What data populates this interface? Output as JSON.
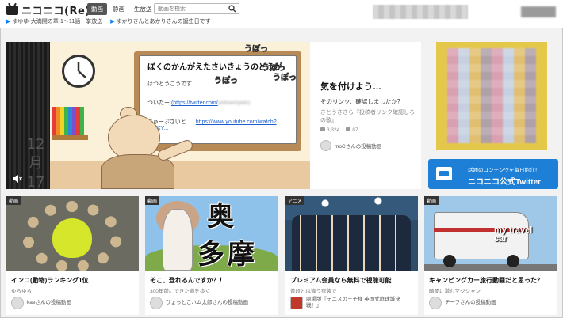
{
  "header": {
    "logo_text": "ニコニコ(Re)",
    "tabs": [
      {
        "label": "動画",
        "active": true
      },
      {
        "label": "静画",
        "active": false
      },
      {
        "label": "生放送",
        "active": false
      }
    ],
    "search_placeholder": "動画を検索",
    "ticker": [
      "ゆゆゆ-大満開の章-1〜11話一挙放送",
      "ゆかりさんとあかりさんの誕生日です"
    ]
  },
  "hero": {
    "board_title": "ぼくのかんがえたさいきょうのどうが",
    "board_line1": "はつとうこうです",
    "board_line2_prefix": "ついたー",
    "board_line2_link": "(https://twitter.com/",
    "board_line2_blur": "yellowmjado)",
    "board_line3_prefix": "ちゅーぶさいと",
    "board_line3_link": "https://www.youtube.com/watch?v=FXY...",
    "puff_text": "うぽっ",
    "date_v1": "12",
    "date_v2": "月",
    "date_v3": "17",
    "title": "気を付けよう…",
    "subtitle": "そのリンク、確認しましたか？",
    "description": "さとうささら『投稿者リンク確認しろの歌』",
    "views": "3,324",
    "comments": "87",
    "author": "moCさんの投稿動画"
  },
  "sidebar": {
    "twitter_small": "話題のコンテンツを毎日紹介！",
    "twitter_big": "ニコニコ公式Twitter"
  },
  "cards": [
    {
      "badge": "動画",
      "title": "インコ(動物)ランキング1位",
      "sub": "ゆらゆら",
      "author": "kaeさんの投稿動画"
    },
    {
      "badge": "動画",
      "title": "そこ、登れるんですか？！",
      "sub": "300年前にできた道を歩く",
      "author": "ひょっとこハム太郎さんの投稿動画",
      "kanji1": "奥",
      "kanji2": "多摩"
    },
    {
      "badge": "アニメ",
      "title": "プレミアム会員なら無料で視聴可能",
      "sub": "普段とは違う衣装で",
      "author": "劇場版『テニスの王子様 英国式庭球城決戦！』"
    },
    {
      "badge": "動画",
      "title": "キャンピングカー旅行動画だと思った？",
      "sub": "暗闇に潜むマジシャン",
      "author": "チーフさんの投稿動画",
      "van_text": "my travel car"
    }
  ],
  "colors": {
    "accent_blue": "#1d7fd6",
    "active_tab": "#555555",
    "ticker_arrow": "#0080ff"
  },
  "icons": [
    "tv-logo-icon",
    "search-icon",
    "clock-icon",
    "mute-icon",
    "play-count-icon",
    "comment-icon",
    "tv-icon"
  ]
}
